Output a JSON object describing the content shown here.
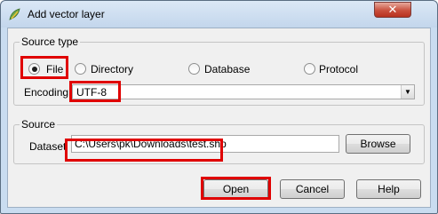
{
  "window": {
    "title": "Add vector layer",
    "close_label": "✕"
  },
  "source_type": {
    "title": "Source type",
    "options": [
      {
        "label": "File",
        "checked": true
      },
      {
        "label": "Directory",
        "checked": false
      },
      {
        "label": "Database",
        "checked": false
      },
      {
        "label": "Protocol",
        "checked": false
      }
    ],
    "encoding_label": "Encoding",
    "encoding_value": "UTF-8"
  },
  "source": {
    "title": "Source",
    "dataset_label": "Dataset",
    "dataset_value": "C:\\Users\\pk\\Downloads\\test.shp",
    "browse_label": "Browse"
  },
  "buttons": {
    "open": "Open",
    "cancel": "Cancel",
    "help": "Help"
  },
  "colors": {
    "highlight": "#e00000",
    "title_bar": "#c9dcf0"
  }
}
